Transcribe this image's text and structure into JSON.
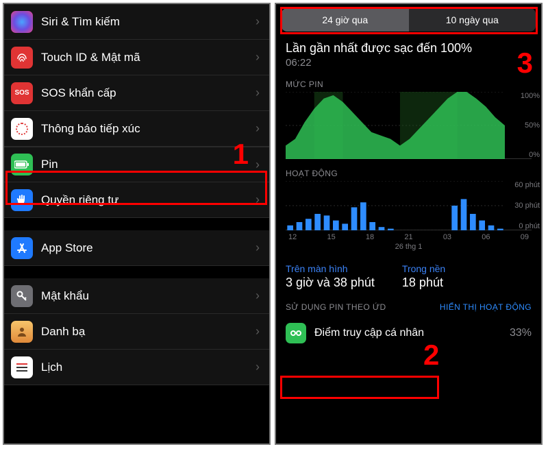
{
  "annotations": {
    "one": "1",
    "two": "2",
    "three": "3"
  },
  "left": {
    "items": [
      {
        "label": "Siri & Tìm kiếm"
      },
      {
        "label": "Touch ID & Mật mã"
      },
      {
        "label": "SOS khẩn cấp"
      },
      {
        "label": "Thông báo tiếp xúc"
      },
      {
        "label": "Pin"
      },
      {
        "label": "Quyền riêng tư"
      },
      {
        "label": "App Store"
      },
      {
        "label": "Mật khẩu"
      },
      {
        "label": "Danh bạ"
      },
      {
        "label": "Lịch"
      }
    ]
  },
  "right": {
    "tabs": {
      "a": "24 giờ qua",
      "b": "10 ngày qua"
    },
    "last_charge_title": "Lần gần nhất được sạc đến 100%",
    "last_charge_time": "06:22",
    "level_label": "MỨC PIN",
    "level_ticks": {
      "t100": "100%",
      "t50": "50%",
      "t0": "0%"
    },
    "activity_label": "HOẠT ĐỘNG",
    "activity_ticks": {
      "t60": "60 phút",
      "t30": "30 phút",
      "t0": "0 phút"
    },
    "x_ticks": [
      "12",
      "15",
      "18",
      "21",
      "03",
      "06",
      "09"
    ],
    "x_date": "26 thg 1",
    "usage": {
      "screen_label": "Trên màn hình",
      "screen_value": "3 giờ và 38 phút",
      "bg_label": "Trong nền",
      "bg_value": "18 phút"
    },
    "byapp_label": "SỬ DỤNG PIN THEO ỨD",
    "show_activity": "HIỂN THỊ HOẠT ĐỘNG",
    "apps": [
      {
        "name": "Điểm truy cập cá nhân",
        "pct": "33%"
      }
    ]
  },
  "chart_data": [
    {
      "type": "area",
      "title": "MỨC PIN",
      "ylabel": "%",
      "ylim": [
        0,
        100
      ],
      "x": [
        12,
        13,
        14,
        15,
        16,
        17,
        18,
        19,
        20,
        21,
        22,
        23,
        0,
        1,
        2,
        3,
        4,
        5,
        6,
        7,
        8,
        9,
        10,
        11
      ],
      "values": [
        20,
        30,
        55,
        75,
        90,
        95,
        85,
        70,
        55,
        40,
        35,
        30,
        20,
        30,
        45,
        60,
        75,
        90,
        100,
        100,
        90,
        78,
        62,
        50
      ],
      "charging_segments": [
        [
          15,
          18
        ],
        [
          0,
          6
        ]
      ]
    },
    {
      "type": "bar",
      "title": "HOẠT ĐỘNG",
      "ylabel": "phút",
      "ylim": [
        0,
        60
      ],
      "x": [
        12,
        13,
        14,
        15,
        16,
        17,
        18,
        19,
        20,
        21,
        22,
        23,
        0,
        1,
        2,
        3,
        4,
        5,
        6,
        7,
        8,
        9,
        10,
        11
      ],
      "values": [
        6,
        10,
        14,
        20,
        18,
        12,
        8,
        28,
        34,
        10,
        4,
        2,
        0,
        0,
        0,
        0,
        0,
        0,
        30,
        38,
        20,
        12,
        6,
        2
      ]
    }
  ]
}
